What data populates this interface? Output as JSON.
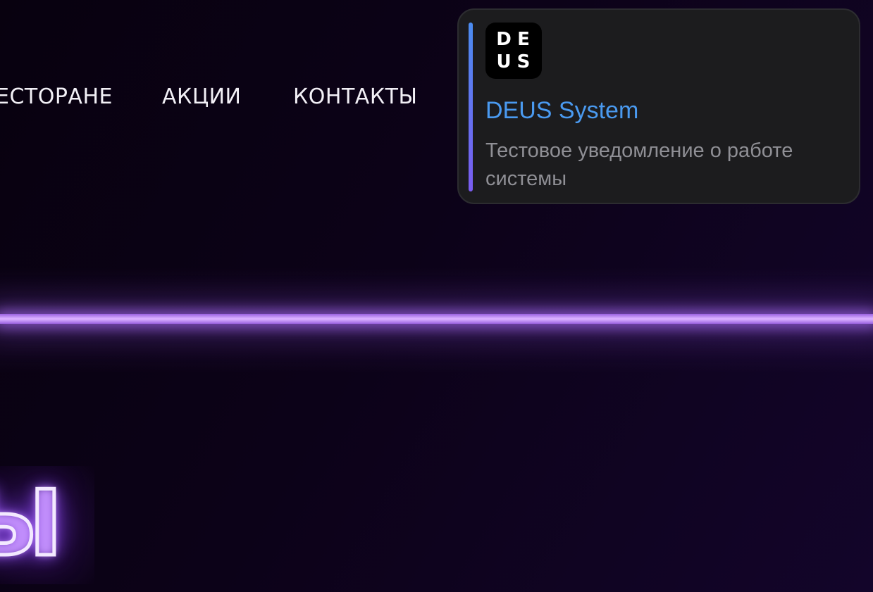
{
  "nav": {
    "items": [
      {
        "label": "ЕСТОРАНЕ"
      },
      {
        "label": "АКЦИИ"
      },
      {
        "label": "КОНТАКТЫ"
      }
    ]
  },
  "hero": {
    "neon_text": "Ы"
  },
  "notification": {
    "logo_letters": [
      "D",
      "E",
      "U",
      "S"
    ],
    "title": "DEUS System",
    "body": "Тестовое уведомление о работе системы"
  },
  "colors": {
    "background": "#0c0218",
    "glow_line": "#d8aeff",
    "notification_bg": "#1c1c1e",
    "notification_title": "#4a9af0",
    "notification_body": "#8f8f95",
    "accent_bar_top": "#4b8cf0",
    "accent_bar_bottom": "#7a5cf0"
  }
}
